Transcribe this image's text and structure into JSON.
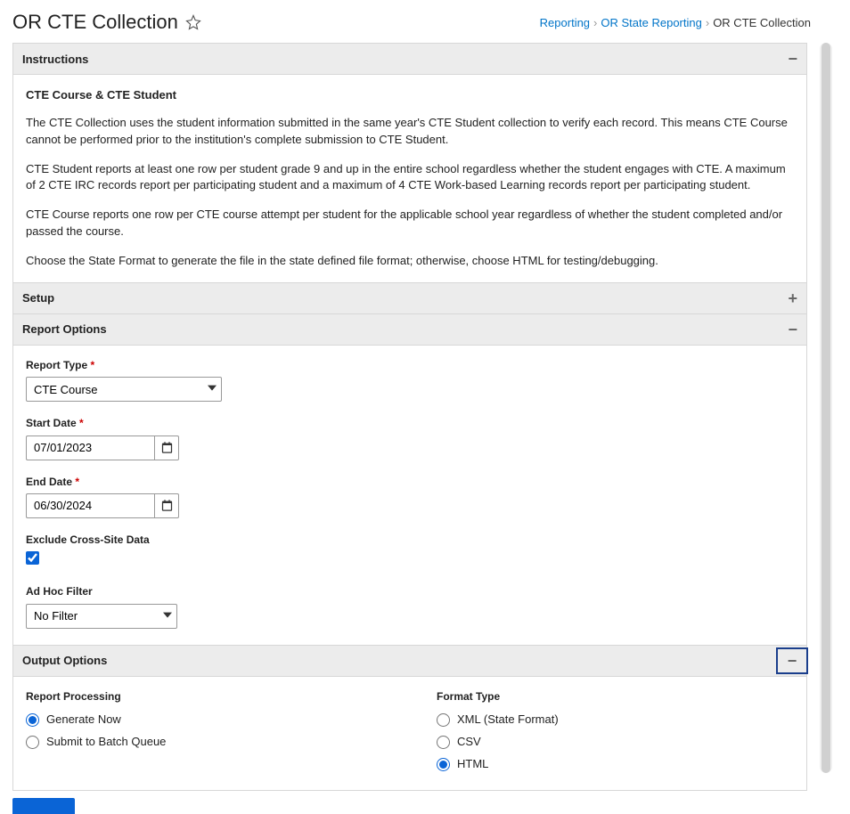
{
  "header": {
    "title": "OR CTE Collection"
  },
  "breadcrumb": {
    "items": [
      "Reporting",
      "OR State Reporting",
      "OR CTE Collection"
    ]
  },
  "instructions": {
    "panel_title": "Instructions",
    "subheading": "CTE Course & CTE Student",
    "p1": "The CTE Collection uses the student information submitted in the same year's CTE Student collection to verify each record. This means CTE Course cannot be performed prior to the institution's complete submission to CTE Student.",
    "p2": "CTE Student reports at least one row per student grade 9 and up in the entire school regardless whether the student engages with CTE. A maximum of 2 CTE IRC records report per participating student and a maximum of 4 CTE Work-based Learning records report per participating student.",
    "p3": "CTE Course reports one row per CTE course attempt per student for the applicable school year regardless of whether the student completed and/or passed the course.",
    "p4": "Choose the State Format to generate the file in the state defined file format; otherwise, choose HTML for testing/debugging."
  },
  "setup": {
    "panel_title": "Setup"
  },
  "report_options": {
    "panel_title": "Report Options",
    "report_type_label": "Report Type",
    "report_type_value": "CTE Course",
    "start_date_label": "Start Date",
    "start_date_value": "07/01/2023",
    "end_date_label": "End Date",
    "end_date_value": "06/30/2024",
    "exclude_label": "Exclude Cross-Site Data",
    "exclude_checked": true,
    "adhoc_label": "Ad Hoc Filter",
    "adhoc_value": "No Filter"
  },
  "output_options": {
    "panel_title": "Output Options",
    "processing_label": "Report Processing",
    "processing_options": [
      "Generate Now",
      "Submit to Batch Queue"
    ],
    "processing_selected": "Generate Now",
    "format_label": "Format Type",
    "format_options": [
      "XML  (State Format)",
      "CSV",
      "HTML"
    ],
    "format_selected": "HTML"
  }
}
